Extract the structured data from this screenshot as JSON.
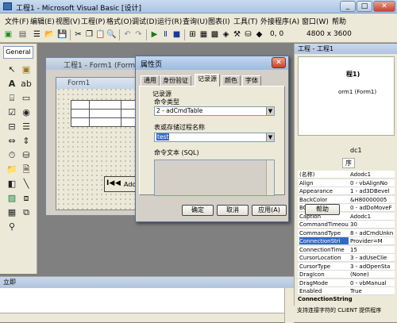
{
  "window": {
    "title": "工程1 - Microsoft Visual Basic [设计]"
  },
  "menu": [
    "文件(F)",
    "编辑(E)",
    "视图(V)",
    "工程(P)",
    "格式(O)",
    "调试(D)",
    "运行(R)",
    "查询(U)",
    "图表(I)",
    "工具(T)",
    "外接程序(A)",
    "窗口(W)",
    "帮助"
  ],
  "toolbar": {
    "position_readout": "0, 0",
    "size_readout": "4800 x 3600"
  },
  "toolbox": {
    "title": "General"
  },
  "project_window": {
    "title": "工程1 - Form1 (Form)"
  },
  "form": {
    "caption": "Form1"
  },
  "adodc": {
    "label": "Adod"
  },
  "project_explorer": {
    "title": "工程 - 工程1",
    "item1": "程1)",
    "item2": "orm1 (Form1)"
  },
  "properties_panel": {
    "object_label": "dc1",
    "tab": "序",
    "rows": [
      {
        "name": "(名称)",
        "value": "Adodc1"
      },
      {
        "name": "Align",
        "value": "0 - vbAlignNo"
      },
      {
        "name": "Appearance",
        "value": "1 - ad3DBevel"
      },
      {
        "name": "BackColor",
        "value": "&H80000005"
      },
      {
        "name": "BOFAction",
        "value": "0 - adDoMoveF"
      },
      {
        "name": "Caption",
        "value": "Adodc1"
      },
      {
        "name": "CommandTimeout",
        "value": "30"
      },
      {
        "name": "CommandType",
        "value": "8 - adCmdUnkn"
      },
      {
        "name": "ConnectionStri",
        "value": "Provider=M"
      },
      {
        "name": "ConnectionTime",
        "value": "15"
      },
      {
        "name": "CursorLocation",
        "value": "3 - adUseClie"
      },
      {
        "name": "CursorType",
        "value": "3 - adOpenSta"
      },
      {
        "name": "DragIcon",
        "value": "(None)"
      },
      {
        "name": "DragMode",
        "value": "0 - vbManual"
      },
      {
        "name": "Enabled",
        "value": "True"
      }
    ],
    "description_title": "ConnectionString",
    "description": "支持连接字符的 CLIENT 提供程序"
  },
  "immediate": {
    "title": "立即"
  },
  "dialog": {
    "title": "属性页",
    "tabs": [
      "通用",
      "身份验证",
      "记录源",
      "颜色",
      "字体"
    ],
    "group_label": "记录源",
    "command_type_label": "命令类型",
    "command_type_value": "2 - adCmdTable",
    "table_label": "表或存储过程名称",
    "table_value": "test",
    "sql_label": "命令文本 (SQL)",
    "buttons": {
      "ok": "确定",
      "cancel": "取消",
      "apply": "应用(A)",
      "help": "帮助"
    }
  },
  "colors": {
    "title_gradient_top": "#c9dcf0",
    "selection": "#316ac5",
    "background": "#808080",
    "face": "#ece9d8"
  }
}
